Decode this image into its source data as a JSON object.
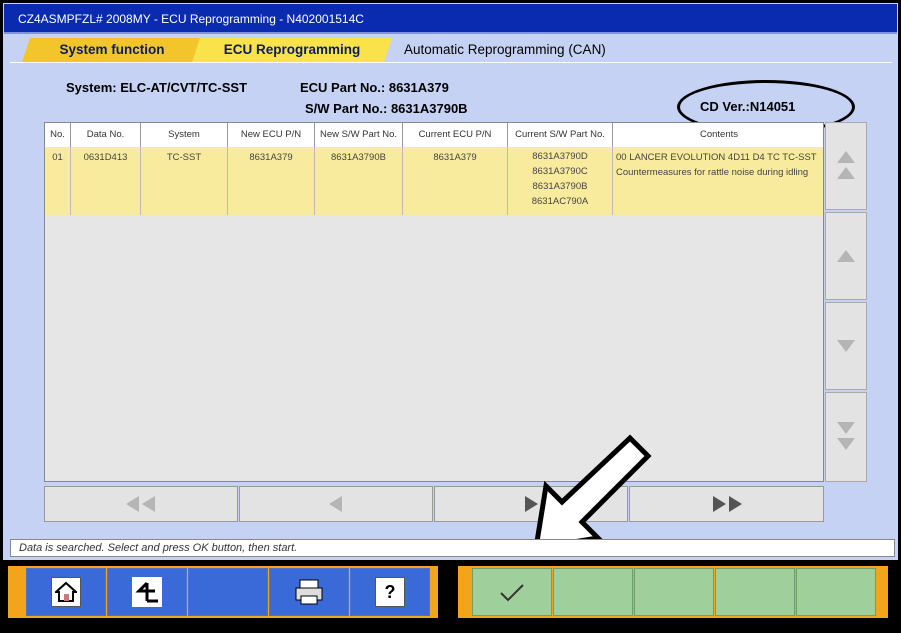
{
  "window": {
    "title": "CZ4ASMPFZL# 2008MY   -  ECU Reprogramming   -  N402001514C"
  },
  "tabs": [
    {
      "label": "System function"
    },
    {
      "label": "ECU Reprogramming"
    },
    {
      "label": "Automatic Reprogramming (CAN)"
    }
  ],
  "info": {
    "system": "System: ELC-AT/CVT/TC-SST",
    "ecu_part": "ECU Part No.: 8631A379",
    "sw_part": "S/W Part No.: 8631A3790B",
    "cd_ver": "CD Ver.:N14051"
  },
  "table": {
    "columns": [
      "No.",
      "Data No.",
      "System",
      "New ECU P/N",
      "New S/W Part No.",
      "Current ECU P/N",
      "Current S/W Part No.",
      "Contents"
    ],
    "rows": [
      {
        "no": "01",
        "data_no": "0631D413",
        "system": "TC-SST",
        "new_ecu": "8631A379",
        "new_sw": "8631A3790B",
        "current_ecu": "8631A379",
        "current_sw": [
          "8631A3790D",
          "8631A3790C",
          "8631A3790B",
          "8631AC790A"
        ],
        "contents": [
          "00 LANCER EVOLUTION 4D11 D4 TC TC-SST",
          "Countermeasures for rattle noise during idling"
        ]
      }
    ]
  },
  "status": {
    "message": "Data is searched. Select and press OK button, then start."
  },
  "colors": {
    "titlebar": "#0a2bb0",
    "background": "#c5d2f3",
    "selected_row": "#f9eb9d",
    "accent_orange": "#f2a51b",
    "ok_green": "#9fcf9a"
  }
}
